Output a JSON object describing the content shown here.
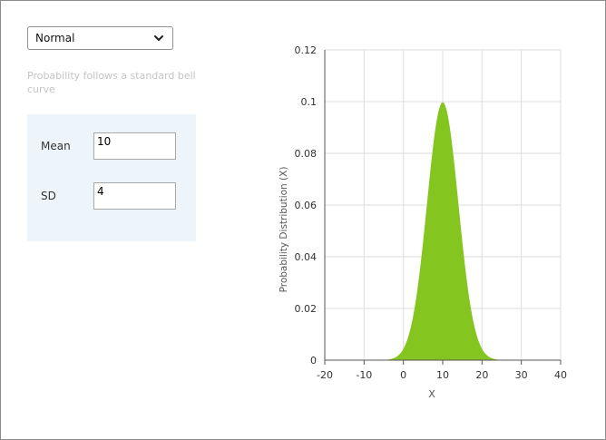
{
  "distribution": {
    "selected": "Normal",
    "description": "Probability follows a standard bell curve"
  },
  "params": {
    "mean_label": "Mean",
    "mean_value": "10",
    "sd_label": "SD",
    "sd_value": "4"
  },
  "chart_data": {
    "type": "area",
    "title": "",
    "xlabel": "X",
    "ylabel": "Probability Distribution (X)",
    "xlim": [
      -20,
      40
    ],
    "ylim": [
      0,
      0.12
    ],
    "x_ticks": [
      -20,
      -10,
      0,
      10,
      20,
      30,
      40
    ],
    "y_ticks": [
      0,
      0.02,
      0.04,
      0.06,
      0.08,
      0.1,
      0.12
    ],
    "x_tick_labels": [
      "-20",
      "-10",
      "0",
      "10",
      "20",
      "30",
      "40"
    ],
    "y_tick_labels": [
      "0",
      "0.02",
      "0.04",
      "0.06",
      "0.08",
      "0.1",
      "0.12"
    ],
    "grid": true,
    "series": [
      {
        "color": "#84c51f",
        "x": [
          -20,
          -15,
          -10,
          -5,
          -2,
          0,
          2,
          4,
          6,
          8,
          10,
          12,
          14,
          16,
          18,
          20,
          22,
          25,
          30,
          35,
          40
        ],
        "y": [
          0,
          0,
          0,
          0.0001,
          0.001,
          0.0044,
          0.0135,
          0.0324,
          0.0605,
          0.088,
          0.0997,
          0.088,
          0.0605,
          0.0324,
          0.0135,
          0.0044,
          0.001,
          0.0001,
          0,
          0,
          0
        ]
      }
    ]
  }
}
